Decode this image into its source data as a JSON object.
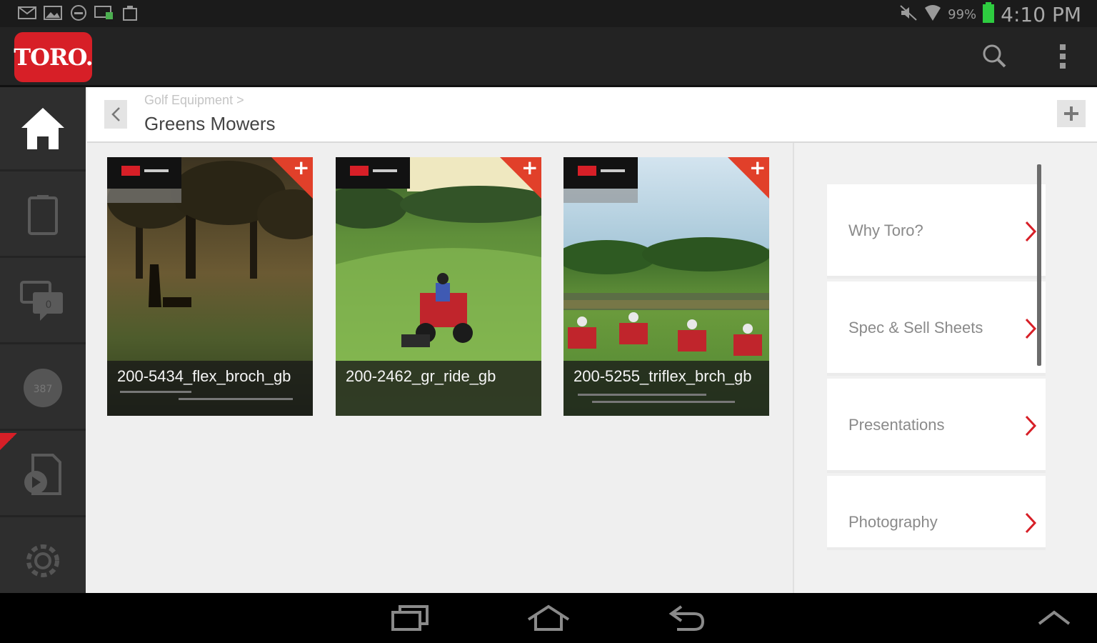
{
  "status_bar": {
    "battery_percent": "99%",
    "time": "4:10 PM",
    "icons": [
      "mail-icon",
      "image-icon",
      "do-not-disturb-icon",
      "screen-cast-icon",
      "clipboard-icon",
      "mute-icon",
      "wifi-icon",
      "battery-icon"
    ]
  },
  "app_bar": {
    "logo_text": "TORO.",
    "search_icon": "search-icon",
    "overflow_icon": "more-vert-icon"
  },
  "sidebar": {
    "items": [
      {
        "icon": "home-icon"
      },
      {
        "icon": "tablet-icon"
      },
      {
        "icon": "chat-icon",
        "badge": "0"
      },
      {
        "icon": "circle-badge-icon",
        "badge": "387"
      },
      {
        "icon": "video-file-icon"
      },
      {
        "icon": "gear-icon"
      }
    ]
  },
  "header": {
    "breadcrumb": "Golf Equipment >",
    "title": "Greens Mowers"
  },
  "documents": [
    {
      "name": "200-5434_flex_broch_gb"
    },
    {
      "name": "200-2462_gr_ride_gb"
    },
    {
      "name": "200-5255_triflex_brch_gb"
    }
  ],
  "right_panel": {
    "items": [
      {
        "label": "Why Toro?"
      },
      {
        "label": "Spec & Sell Sheets"
      },
      {
        "label": "Presentations"
      },
      {
        "label": "Photography"
      }
    ]
  },
  "colors": {
    "brand_red": "#d71f27",
    "accent_orange": "#e1402a",
    "dark_bar": "#232323",
    "sidebar_bg": "#2e2e2e"
  }
}
